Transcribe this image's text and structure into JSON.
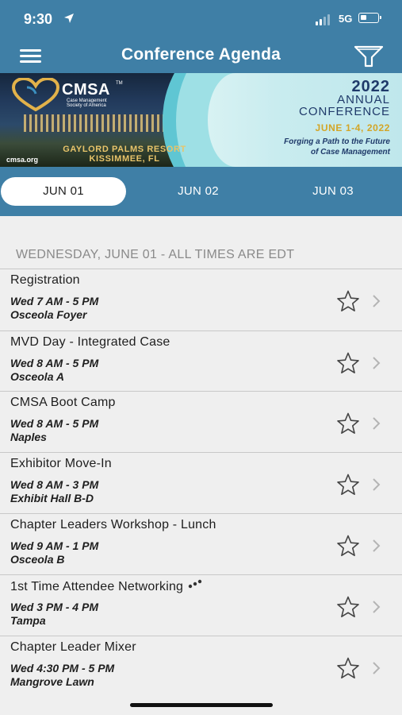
{
  "status_bar": {
    "time": "9:30",
    "network": "5G",
    "icons": [
      "location-arrow-icon",
      "signal-icon",
      "battery-icon"
    ]
  },
  "header": {
    "title": "Conference Agenda",
    "menu_icon": "hamburger-menu-icon",
    "filter_icon": "filter-funnel-icon"
  },
  "banner": {
    "logo_text": "CMSA",
    "logo_tm": "TM",
    "logo_subtitle": "Case Management Society of America",
    "resort_line1": "GAYLORD PALMS RESORT",
    "resort_line2": "KISSIMMEE, FL",
    "site": "cmsa.org",
    "year": "2022",
    "line1": "ANNUAL",
    "line2": "CONFERENCE",
    "dates": "JUNE 1-4, 2022",
    "tagline1": "Forging a Path to the Future",
    "tagline2": "of Case Management"
  },
  "tabs": [
    {
      "label": "JUN 01",
      "active": true
    },
    {
      "label": "JUN 02",
      "active": false
    },
    {
      "label": "JUN 03",
      "active": false
    }
  ],
  "section_header": "WEDNESDAY, JUNE 01 - ALL TIMES ARE EDT",
  "sessions": [
    {
      "title": "Registration",
      "time": "Wed 7 AM - 5 PM",
      "location": "Osceola Foyer"
    },
    {
      "title": "MVD Day - Integrated Case",
      "time": "Wed 8 AM - 5 PM",
      "location": "Osceola A"
    },
    {
      "title": "CMSA Boot Camp",
      "time": "Wed 8 AM - 5 PM",
      "location": "Naples"
    },
    {
      "title": "Exhibitor Move-In",
      "time": "Wed 8 AM - 3 PM",
      "location": "Exhibit Hall B-D"
    },
    {
      "title": "Chapter Leaders Workshop - Lunch",
      "time": "Wed 9 AM - 1 PM",
      "location": "Osceola B"
    },
    {
      "title": "1st Time Attendee Networking",
      "time": "Wed 3 PM - 4 PM",
      "location": "Tampa",
      "icon": "networking-people-icon"
    },
    {
      "title": "Chapter Leader Mixer",
      "time": "Wed 4:30 PM - 5 PM",
      "location": "Mangrove Lawn"
    }
  ],
  "colors": {
    "header_blue": "#3f7fa6",
    "background": "#efefef",
    "text": "#1e1e1e",
    "section_gray": "#8a8a8a"
  }
}
